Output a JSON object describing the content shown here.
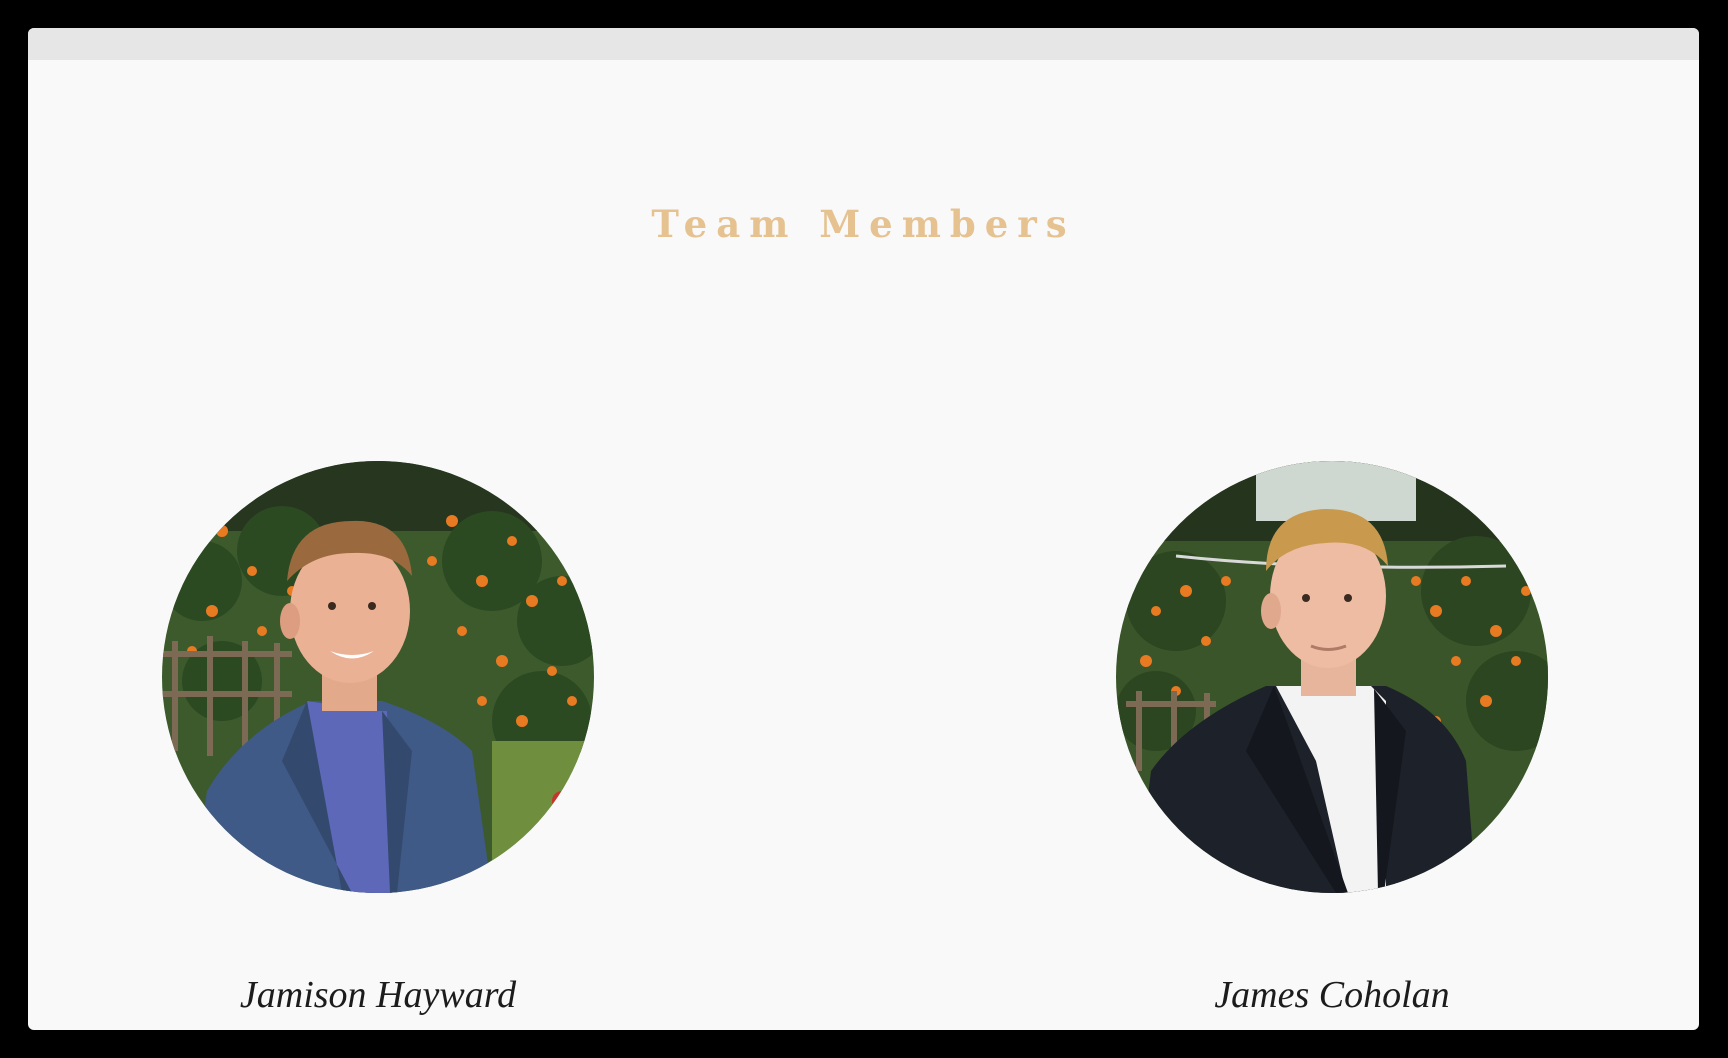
{
  "section": {
    "title": "Team Members"
  },
  "members": [
    {
      "name": "Jamison Hayward",
      "photo": "portrait-photo",
      "jacket_color": "#3f5a86",
      "shirt_color": "#5e68b8",
      "hair_color": "#9a6a3e"
    },
    {
      "name": "James Coholan",
      "photo": "portrait-photo",
      "jacket_color": "#1d2129",
      "shirt_color": "#f3f3f3",
      "hair_color": "#c9994e"
    }
  ],
  "colors": {
    "heading": "#e5c290",
    "background": "#f9f9f9",
    "name_text": "#1c1c1c"
  }
}
